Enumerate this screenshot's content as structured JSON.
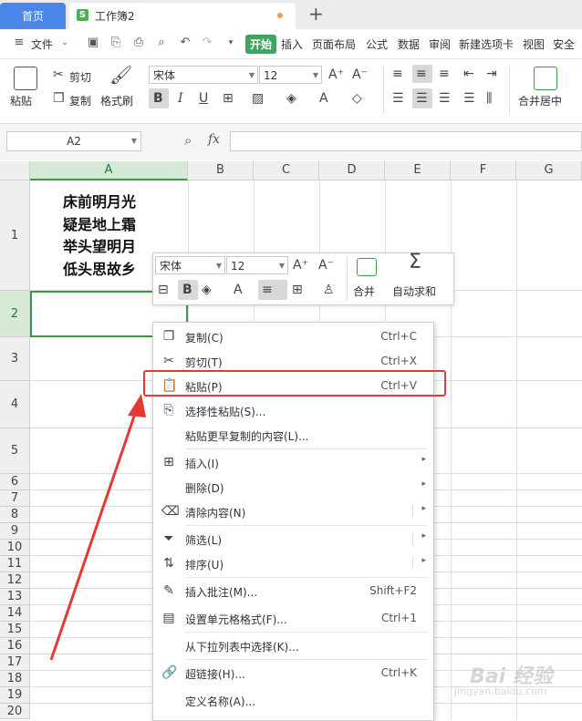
{
  "tabs": {
    "home": "首页",
    "workbook": "工作簿2",
    "workbook_icon": "S"
  },
  "menu": {
    "file": "文件",
    "items": [
      "开始",
      "插入",
      "页面布局",
      "公式",
      "数据",
      "审阅",
      "新建选项卡",
      "视图",
      "安全"
    ]
  },
  "ribbon": {
    "paste": "粘贴",
    "cut": "剪切",
    "copy": "复制",
    "format_painter": "格式刷",
    "font": "宋体",
    "size": "12",
    "merge_center": "合并居中"
  },
  "formula_bar": {
    "cell_ref": "A2",
    "fx": "fx",
    "value": ""
  },
  "columns": [
    "A",
    "B",
    "C",
    "D",
    "E",
    "F",
    "G"
  ],
  "rows": [
    "1",
    "2",
    "3",
    "4",
    "5",
    "6",
    "7",
    "8",
    "9",
    "10",
    "11",
    "12",
    "13",
    "14",
    "15",
    "16",
    "17",
    "18",
    "19",
    "20"
  ],
  "cell_A1": [
    "床前明月光",
    "疑是地上霜",
    "举头望明月",
    "低头思故乡"
  ],
  "mini_toolbar": {
    "font": "宋体",
    "size": "12",
    "merge": "合并",
    "autosum": "自动求和"
  },
  "context_menu": [
    {
      "label": "复制(C)",
      "shortcut": "Ctrl+C",
      "icon": "copy-icon"
    },
    {
      "label": "剪切(T)",
      "shortcut": "Ctrl+X",
      "icon": "scissors-icon"
    },
    {
      "label": "粘贴(P)",
      "shortcut": "Ctrl+V",
      "icon": "clipboard-icon"
    },
    {
      "label": "选择性粘贴(S)...",
      "shortcut": "",
      "icon": "paste-special-icon"
    },
    {
      "label": "粘贴更早复制的内容(L)...",
      "shortcut": "",
      "icon": ""
    },
    {
      "label": "插入(I)",
      "shortcut": "",
      "icon": "insert-icon"
    },
    {
      "label": "删除(D)",
      "shortcut": "",
      "icon": ""
    },
    {
      "label": "清除内容(N)",
      "shortcut": "",
      "icon": "eraser-icon"
    },
    {
      "label": "筛选(L)",
      "shortcut": "",
      "icon": "filter-icon"
    },
    {
      "label": "排序(U)",
      "shortcut": "",
      "icon": "sort-icon"
    },
    {
      "label": "插入批注(M)...",
      "shortcut": "Shift+F2",
      "icon": "comment-icon"
    },
    {
      "label": "设置单元格格式(F)...",
      "shortcut": "Ctrl+1",
      "icon": "format-cells-icon"
    },
    {
      "label": "从下拉列表中选择(K)...",
      "shortcut": "",
      "icon": ""
    },
    {
      "label": "超链接(H)...",
      "shortcut": "Ctrl+K",
      "icon": "link-icon"
    },
    {
      "label": "定义名称(A)...",
      "shortcut": "",
      "icon": ""
    }
  ],
  "watermark": {
    "brand": "Bai 经验",
    "url": "jingyan.baidu.com"
  },
  "colors": {
    "accent_green": "#3fa55e",
    "tab_blue": "#4a86e8",
    "highlight_red": "#e53935"
  }
}
